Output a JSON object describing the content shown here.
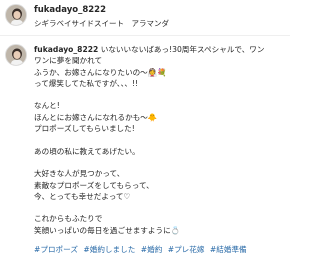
{
  "header": {
    "username": "fukadayo_8222",
    "location": "シギラベイサイドスイート　アラマンダ"
  },
  "caption": {
    "username": "fukadayo_8222",
    "lines": [
      "いないいないばあっ!30周年スペシャルで、ワン",
      "ワンに夢を聞かれて",
      "ふうか、お嫁さんになりたいの〜👰💐",
      "って爆笑してた私ですが、、、!!",
      "",
      "なんと!",
      "ほんとにお嫁さんになれるかも〜🐥",
      "プロポーズしてもらいました!",
      "",
      "あの頃の私に教えてあげたい。",
      "",
      "大好きな人が見つかって、",
      "素敵なプロポーズをしてもらって、",
      "今、とっても幸せだよって♡",
      "",
      "これからもふたりで",
      "笑顔いっぱいの毎日を過ごせますように💍"
    ]
  },
  "hashtags": [
    "#プロポーズ",
    "#婚約しました",
    "#婚約",
    "#プレ花嫁",
    "#結婚準備"
  ],
  "colors": {
    "text": "#262626",
    "hashtag": "#2a6ba8",
    "divider": "#efefef"
  }
}
